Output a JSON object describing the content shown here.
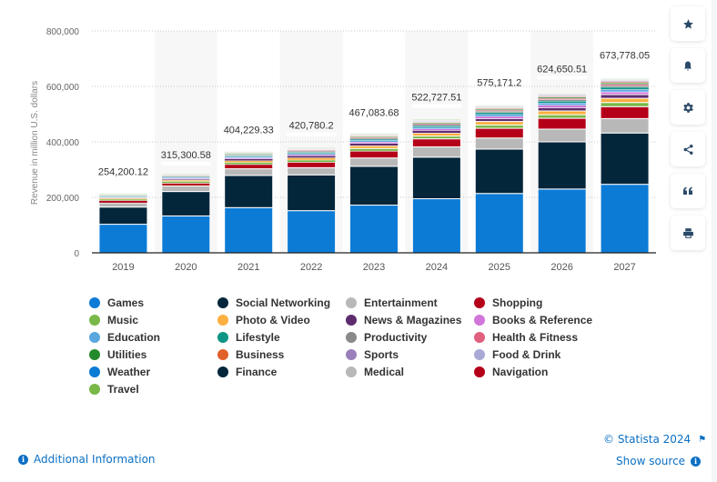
{
  "chart_data": {
    "type": "bar",
    "stacked": true,
    "title": "",
    "xlabel": "",
    "ylabel": "Revenue in million U.S. dollars",
    "ylim": [
      0,
      800000
    ],
    "yticks": [
      0,
      200000,
      400000,
      600000,
      800000
    ],
    "ytick_labels": [
      "0",
      "200,000",
      "400,000",
      "600,000",
      "800,000"
    ],
    "grid": true,
    "categories": [
      "2019",
      "2020",
      "2021",
      "2022",
      "2023",
      "2024",
      "2025",
      "2026",
      "2027"
    ],
    "totals": [
      254200.12,
      315300.58,
      404229.33,
      420780.2,
      467083.68,
      522727.51,
      575171.2,
      624650.51,
      673778.05
    ],
    "total_labels": [
      "254,200.12",
      "315,300.58",
      "404,229.33",
      "420,780.2",
      "467,083.68",
      "522,727.51",
      "575,171.2",
      "624,650.51",
      "673,778.05"
    ],
    "legend_position": "bottom",
    "series": [
      {
        "name": "Games",
        "color": "#0b7bd6",
        "values": [
          103000,
          133000,
          163000,
          152000,
          172000,
          195000,
          214000,
          230000,
          247000
        ]
      },
      {
        "name": "Social Networking",
        "color": "#03263b",
        "values": [
          62000,
          88000,
          116000,
          129000,
          140000,
          150000,
          160000,
          170000,
          185000
        ]
      },
      {
        "name": "Entertainment",
        "color": "#b8b8b8",
        "values": [
          15000,
          20000,
          24000,
          26000,
          30000,
          37000,
          40000,
          46000,
          52000
        ]
      },
      {
        "name": "Shopping",
        "color": "#b5001a",
        "values": [
          8500,
          10500,
          16000,
          20000,
          25000,
          29000,
          35000,
          39000,
          43000
        ]
      },
      {
        "name": "Music",
        "color": "#78b848",
        "values": [
          5000,
          6000,
          7000,
          7500,
          9000,
          10000,
          12000,
          13000,
          15000
        ]
      },
      {
        "name": "Photo & Video",
        "color": "#fbb040",
        "values": [
          3500,
          4500,
          6000,
          8000,
          10000,
          10500,
          12500,
          13500,
          15000
        ]
      },
      {
        "name": "News & Magazines",
        "color": "#5e2c6e",
        "values": [
          2000,
          3500,
          7000,
          7500,
          8500,
          9500,
          10500,
          12000,
          13500
        ]
      },
      {
        "name": "Books & Reference",
        "color": "#d175db",
        "values": [
          1500,
          2500,
          3500,
          4000,
          5000,
          6000,
          8000,
          9000,
          10000
        ]
      },
      {
        "name": "Education",
        "color": "#5aa7e0",
        "values": [
          1500,
          3500,
          4000,
          4500,
          5500,
          6000,
          7000,
          7500,
          8500
        ]
      },
      {
        "name": "Lifestyle",
        "color": "#0d9585",
        "values": [
          3500,
          2500,
          3500,
          4000,
          5000,
          5500,
          6500,
          7000,
          8000
        ]
      },
      {
        "name": "Productivity",
        "color": "#8a8a8a",
        "values": [
          1500,
          3500,
          2000,
          4500,
          4000,
          4500,
          5000,
          5500,
          6000
        ]
      },
      {
        "name": "Health & Fitness",
        "color": "#e0607e",
        "values": [
          1000,
          1500,
          2000,
          2500,
          3000,
          3500,
          4000,
          4500,
          5000
        ]
      },
      {
        "name": "Utilities",
        "color": "#248a2c",
        "values": [
          1000,
          1500,
          3500,
          2000,
          3000,
          3000,
          3500,
          4000,
          4500
        ]
      },
      {
        "name": "Business",
        "color": "#e0612a",
        "values": [
          800,
          1000,
          1500,
          1800,
          2000,
          2300,
          2500,
          2800,
          3000
        ]
      },
      {
        "name": "Sports",
        "color": "#9b7fbb",
        "values": [
          800,
          1000,
          1200,
          1500,
          1800,
          2000,
          2300,
          2500,
          2800
        ]
      },
      {
        "name": "Food & Drink",
        "color": "#a9a9d6",
        "values": [
          700,
          900,
          1100,
          1300,
          1500,
          1800,
          2000,
          2200,
          2400
        ]
      },
      {
        "name": "Finance",
        "color": "#03263b",
        "values": [
          600,
          700,
          900,
          1100,
          1300,
          1500,
          1700,
          1900,
          2100
        ]
      },
      {
        "name": "Navigation",
        "color": "#b5001a",
        "values": [
          500,
          600,
          700,
          800,
          900,
          1000,
          1100,
          1200,
          1300
        ]
      },
      {
        "name": "Medical",
        "color": "#b8b8b8",
        "values": [
          400,
          500,
          600,
          700,
          800,
          900,
          1000,
          1100,
          1200
        ]
      },
      {
        "name": "Weather",
        "color": "#0b7bd6",
        "values": [
          300,
          400,
          500,
          600,
          700,
          800,
          900,
          1000,
          1100
        ]
      },
      {
        "name": "Travel",
        "color": "#78b848",
        "values": [
          200,
          300,
          400,
          500,
          600,
          700,
          800,
          900,
          1000
        ]
      }
    ]
  },
  "legend": [
    {
      "label": "Games",
      "color": "#0b7bd6"
    },
    {
      "label": "Social Networking",
      "color": "#03263b"
    },
    {
      "label": "Entertainment",
      "color": "#b8b8b8"
    },
    {
      "label": "Shopping",
      "color": "#b5001a"
    },
    {
      "label": "Music",
      "color": "#78b848"
    },
    {
      "label": "Photo & Video",
      "color": "#fbb040"
    },
    {
      "label": "News & Magazines",
      "color": "#5e2c6e"
    },
    {
      "label": "Books & Reference",
      "color": "#d175db"
    },
    {
      "label": "Education",
      "color": "#5aa7e0"
    },
    {
      "label": "Lifestyle",
      "color": "#0d9585"
    },
    {
      "label": "Productivity",
      "color": "#8a8a8a"
    },
    {
      "label": "Health & Fitness",
      "color": "#e0607e"
    },
    {
      "label": "Utilities",
      "color": "#248a2c"
    },
    {
      "label": "Business",
      "color": "#e0612a"
    },
    {
      "label": "Sports",
      "color": "#9b7fbb"
    },
    {
      "label": "Food & Drink",
      "color": "#a9a9d6"
    },
    {
      "label": "Weather",
      "color": "#0b7bd6"
    },
    {
      "label": "Finance",
      "color": "#03263b"
    },
    {
      "label": "Medical",
      "color": "#b8b8b8"
    },
    {
      "label": "Navigation",
      "color": "#b5001a"
    },
    {
      "label": "Travel",
      "color": "#78b848"
    }
  ],
  "sidebar": {
    "buttons": [
      {
        "name": "favorite-button",
        "icon": "star-icon",
        "glyph": "★"
      },
      {
        "name": "notification-button",
        "icon": "bell-icon",
        "glyph": "🔔"
      },
      {
        "name": "settings-button",
        "icon": "gear-icon",
        "glyph": "⚙"
      },
      {
        "name": "share-button",
        "icon": "share-icon",
        "glyph": "share"
      },
      {
        "name": "cite-button",
        "icon": "quote-icon",
        "glyph": "❝"
      },
      {
        "name": "print-button",
        "icon": "printer-icon",
        "glyph": "⎙"
      }
    ]
  },
  "footer": {
    "additional_info": "Additional Information",
    "copyright": "© Statista 2024",
    "show_source": "Show source",
    "info_glyph": "i"
  }
}
